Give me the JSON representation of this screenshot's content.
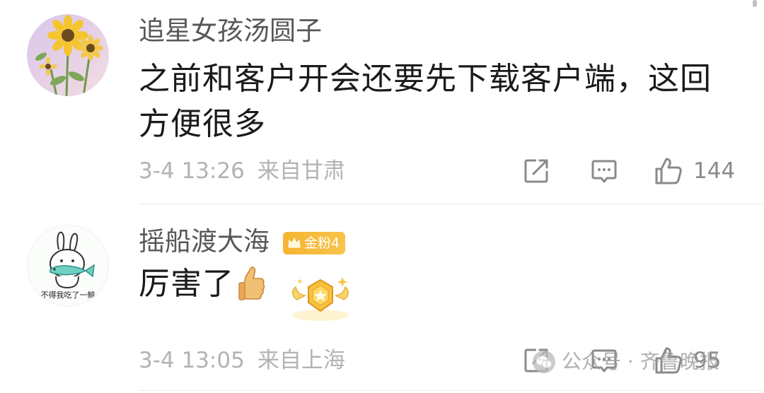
{
  "comments": [
    {
      "username": "追星女孩汤圆子",
      "content": "之前和客户开会还要先下载客户端，这回方便很多",
      "time": "3-4 13:26",
      "location": "来自甘肃",
      "likes": "144",
      "avatar_icon": "sunflower-avatar"
    },
    {
      "username": "摇船渡大海",
      "badge": "金粉4",
      "content": "厉害了",
      "time": "3-4 13:05",
      "location": "来自上海",
      "likes": "95",
      "avatar_icon": "rabbit-fish-avatar",
      "avatar_caption": "不得我吃了一鲸"
    }
  ],
  "watermark": {
    "text": "公众号 · 齐鲁晚报"
  },
  "icons": {
    "share": "share-icon",
    "comment": "comment-icon",
    "like": "thumbs-up-icon"
  },
  "colors": {
    "username": "#575757",
    "content": "#1a1a1a",
    "meta": "#b3b3b3",
    "badge": "#f5b431"
  }
}
